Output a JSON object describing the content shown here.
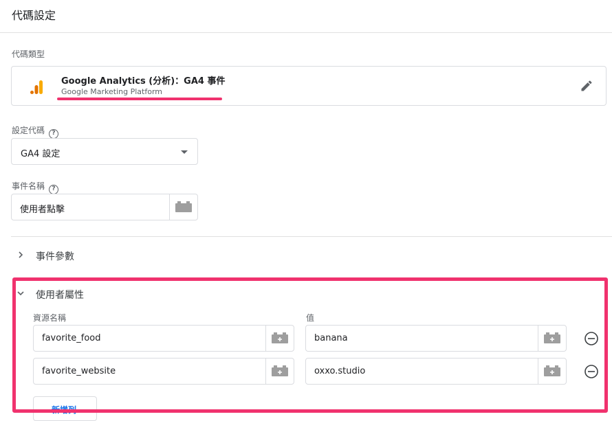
{
  "header": {
    "title": "代碼設定"
  },
  "tag_type": {
    "label": "代碼類型",
    "title": "Google Analytics (分析)：GA4 事件",
    "subtitle": "Google Marketing Platform",
    "logo_icon": "google-analytics-logo",
    "edit_icon": "pencil-icon"
  },
  "config_tag": {
    "label": "設定代碼",
    "help_icon": "?",
    "value": "GA4 設定"
  },
  "event_name": {
    "label": "事件名稱",
    "help_icon": "?",
    "value": "使用者點擊"
  },
  "event_params": {
    "label": "事件參數"
  },
  "user_properties": {
    "label": "使用者屬性",
    "col_name": "資源名稱",
    "col_value": "值",
    "rows": [
      {
        "name": "favorite_food",
        "value": "banana"
      },
      {
        "name": "favorite_website",
        "value": "oxxo.studio"
      }
    ],
    "add_row_label": "新增列"
  },
  "colors": {
    "highlight": "#f0326e",
    "link": "#1a73e8",
    "ga_orange": "#f9ab00",
    "ga_dark_orange": "#e37400"
  }
}
